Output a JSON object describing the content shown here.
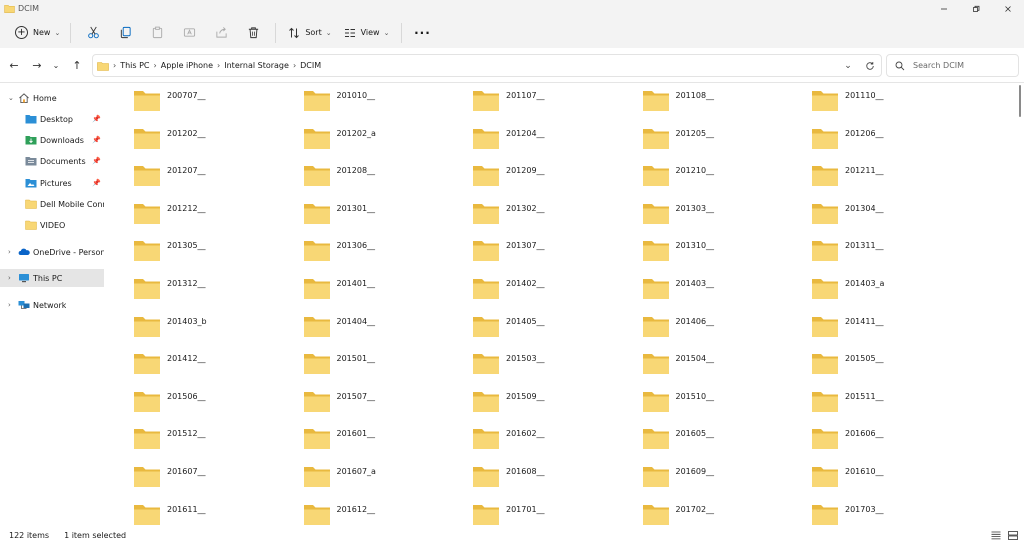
{
  "window": {
    "title": "DCIM",
    "accent": "#0067c0",
    "folder_color": "#f8d775"
  },
  "commandbar": {
    "new_label": "New",
    "sort_label": "Sort",
    "view_label": "View"
  },
  "address": {
    "breadcrumbs": [
      "This PC",
      "Apple iPhone",
      "Internal Storage",
      "DCIM"
    ]
  },
  "search": {
    "placeholder": "Search DCIM"
  },
  "sidebar": {
    "items": [
      {
        "label": "Home",
        "icon": "home-icon",
        "expandable": true,
        "pinned": false
      },
      {
        "label": "Desktop",
        "icon": "desktop-folder-icon",
        "expandable": false,
        "pinned": true
      },
      {
        "label": "Downloads",
        "icon": "downloads-folder-icon",
        "expandable": false,
        "pinned": true
      },
      {
        "label": "Documents",
        "icon": "documents-folder-icon",
        "expandable": false,
        "pinned": true
      },
      {
        "label": "Pictures",
        "icon": "pictures-folder-icon",
        "expandable": false,
        "pinned": true
      },
      {
        "label": "Dell Mobile Conne",
        "icon": "folder-icon",
        "expandable": false,
        "pinned": false
      },
      {
        "label": "VIDEO",
        "icon": "folder-icon",
        "expandable": false,
        "pinned": false
      },
      {
        "label": "OneDrive - Personal",
        "icon": "onedrive-icon",
        "expandable": true,
        "pinned": false
      },
      {
        "label": "This PC",
        "icon": "this-pc-icon",
        "expandable": true,
        "pinned": false,
        "selected": true
      },
      {
        "label": "Network",
        "icon": "network-icon",
        "expandable": true,
        "pinned": false
      }
    ]
  },
  "folders": [
    "200707__",
    "201010__",
    "201107__",
    "201108__",
    "201110__",
    "201202__",
    "201202_a",
    "201204__",
    "201205__",
    "201206__",
    "201207__",
    "201208__",
    "201209__",
    "201210__",
    "201211__",
    "201212__",
    "201301__",
    "201302__",
    "201303__",
    "201304__",
    "201305__",
    "201306__",
    "201307__",
    "201310__",
    "201311__",
    "201312__",
    "201401__",
    "201402__",
    "201403__",
    "201403_a",
    "201403_b",
    "201404__",
    "201405__",
    "201406__",
    "201411__",
    "201412__",
    "201501__",
    "201503__",
    "201504__",
    "201505__",
    "201506__",
    "201507__",
    "201509__",
    "201510__",
    "201511__",
    "201512__",
    "201601__",
    "201602__",
    "201605__",
    "201606__",
    "201607__",
    "201607_a",
    "201608__",
    "201609__",
    "201610__",
    "201611__",
    "201612__",
    "201701__",
    "201702__",
    "201703__"
  ],
  "status": {
    "item_count": "122 items",
    "selection": "1 item selected"
  }
}
